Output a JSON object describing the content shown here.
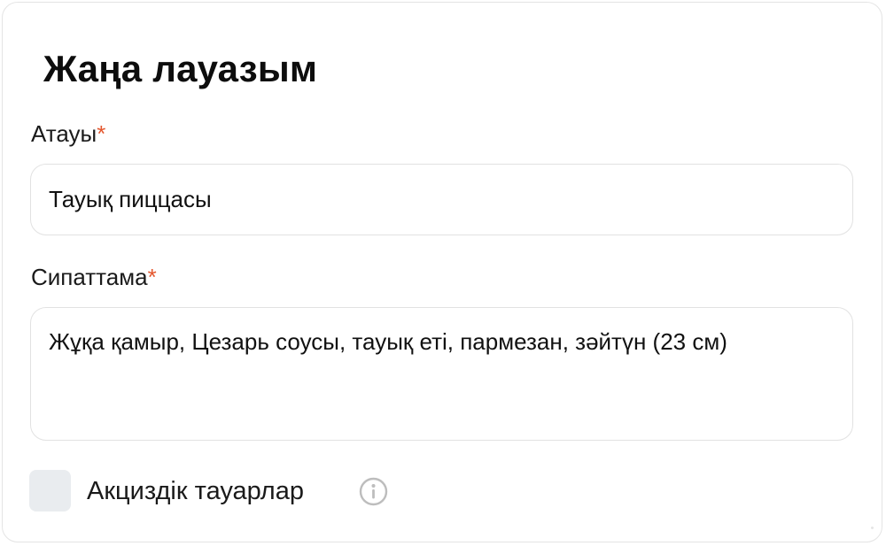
{
  "form": {
    "title": "Жаңа лауазым",
    "required_mark": "*",
    "name_field": {
      "label": "Атауы",
      "value": "Тауық пиццасы"
    },
    "description_field": {
      "label": "Сипаттама",
      "value": "Жұқа қамыр, Цезарь соусы, тауық еті, пармезан, зәйтүн (23 см)"
    },
    "excise_checkbox": {
      "label": "Акциздік тауарлар",
      "checked": false
    },
    "icons": {
      "info": "info-icon"
    },
    "colors": {
      "required": "#e4572e",
      "checkbox_bg": "#e9ecef",
      "border": "#e2e2e2"
    }
  }
}
